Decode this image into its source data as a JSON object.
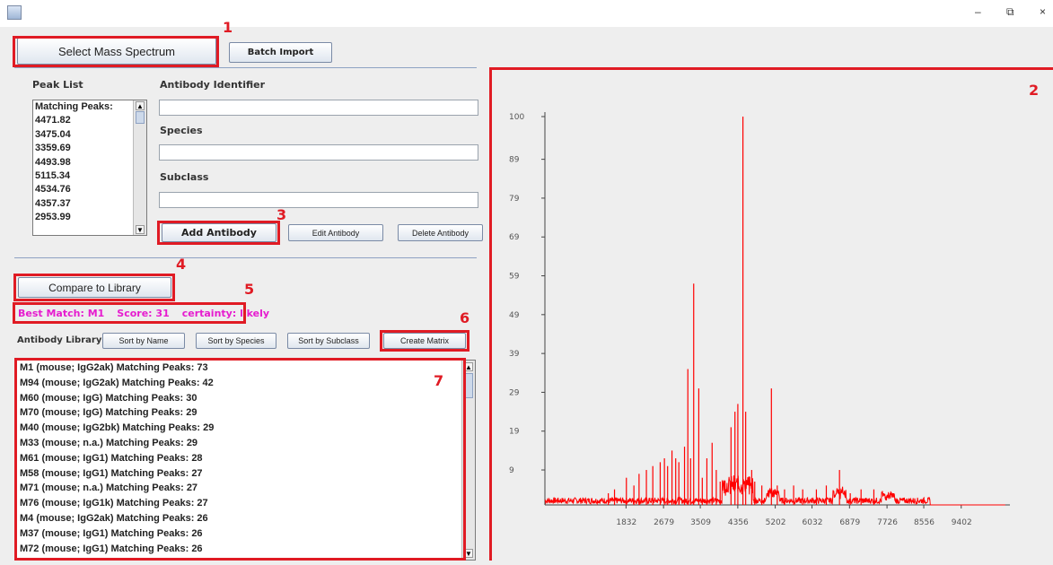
{
  "window": {
    "minimize": "–",
    "restore": "⧉",
    "close": "×"
  },
  "toolbar": {
    "select_mass_spectrum": "Select Mass Spectrum",
    "batch_import": "Batch Import"
  },
  "peak_list": {
    "label": "Peak List",
    "items": [
      "Matching Peaks:",
      "4471.82",
      "3475.04",
      "3359.69",
      "4493.98",
      "5115.34",
      "4534.76",
      "4357.37",
      "2953.99"
    ]
  },
  "antibody_form": {
    "identifier_label": "Antibody Identifier",
    "species_label": "Species",
    "subclass_label": "Subclass",
    "identifier_value": "",
    "species_value": "",
    "subclass_value": "",
    "add_button": "Add Antibody",
    "edit_button": "Edit Antibody",
    "delete_button": "Delete Antibody"
  },
  "compare_button": "Compare to Library",
  "best_match": {
    "match": "Best Match: M1",
    "score": "Score: 31",
    "certainty": "certainty: likely"
  },
  "library": {
    "label": "Antibody Library",
    "sort_name": "Sort by Name",
    "sort_species": "Sort by Species",
    "sort_subclass": "Sort by Subclass",
    "create_matrix": "Create Matrix",
    "items": [
      "M1 (mouse; IgG2ak) Matching Peaks: 73",
      "M94 (mouse; IgG2ak) Matching Peaks: 42",
      "M60 (mouse; IgG) Matching Peaks: 30",
      "M70 (mouse; IgG) Matching Peaks: 29",
      "M40 (mouse; IgG2bk) Matching Peaks: 29",
      "M33 (mouse; n.a.) Matching Peaks: 29",
      "M61 (mouse; IgG1) Matching Peaks: 28",
      "M58 (mouse; IgG1) Matching Peaks: 27",
      "M71 (mouse; n.a.) Matching Peaks: 27",
      "M76 (mouse; IgG1k) Matching Peaks: 27",
      "M4 (mouse; IgG2ak) Matching Peaks: 26",
      "M37 (mouse; IgG1) Matching Peaks: 26",
      "M72 (mouse; IgG1) Matching Peaks: 26"
    ]
  },
  "annotations": [
    "1",
    "2",
    "3",
    "4",
    "5",
    "6",
    "7"
  ],
  "colors": {
    "highlight": "#e01b24",
    "match_text": "#e61ccf",
    "spectrum": "#ff0000"
  },
  "chart_data": {
    "type": "line",
    "yticks": [
      "9",
      "19",
      "29",
      "39",
      "49",
      "59",
      "69",
      "79",
      "89",
      "100"
    ],
    "xticks": [
      "1832",
      "2679",
      "3509",
      "4356",
      "5202",
      "6032",
      "6879",
      "7726",
      "8556",
      "9402"
    ],
    "xlim": [
      0,
      10400
    ],
    "ylim": [
      0,
      100
    ],
    "peaks": [
      {
        "x": 1432,
        "y": 3
      },
      {
        "x": 1572,
        "y": 4
      },
      {
        "x": 1840,
        "y": 7
      },
      {
        "x": 2010,
        "y": 5
      },
      {
        "x": 2126,
        "y": 8
      },
      {
        "x": 2292,
        "y": 9
      },
      {
        "x": 2437,
        "y": 10
      },
      {
        "x": 2604,
        "y": 11
      },
      {
        "x": 2699,
        "y": 12
      },
      {
        "x": 2771,
        "y": 10
      },
      {
        "x": 2870,
        "y": 14
      },
      {
        "x": 2954,
        "y": 12
      },
      {
        "x": 3025,
        "y": 11
      },
      {
        "x": 3153,
        "y": 15
      },
      {
        "x": 3228,
        "y": 35
      },
      {
        "x": 3290,
        "y": 12
      },
      {
        "x": 3360,
        "y": 57
      },
      {
        "x": 3475,
        "y": 30
      },
      {
        "x": 3554,
        "y": 7
      },
      {
        "x": 3658,
        "y": 12
      },
      {
        "x": 3776,
        "y": 16
      },
      {
        "x": 3870,
        "y": 9
      },
      {
        "x": 3958,
        "y": 6
      },
      {
        "x": 4203,
        "y": 20
      },
      {
        "x": 4292,
        "y": 24
      },
      {
        "x": 4357,
        "y": 26
      },
      {
        "x": 4472,
        "y": 100
      },
      {
        "x": 4534,
        "y": 24
      },
      {
        "x": 4670,
        "y": 9
      },
      {
        "x": 4739,
        "y": 6
      },
      {
        "x": 4899,
        "y": 5
      },
      {
        "x": 5115,
        "y": 30
      },
      {
        "x": 5247,
        "y": 5
      },
      {
        "x": 5412,
        "y": 4
      },
      {
        "x": 5617,
        "y": 5
      },
      {
        "x": 5822,
        "y": 4
      },
      {
        "x": 6131,
        "y": 4
      },
      {
        "x": 6355,
        "y": 5
      },
      {
        "x": 6653,
        "y": 9
      },
      {
        "x": 6896,
        "y": 3
      },
      {
        "x": 7140,
        "y": 4
      },
      {
        "x": 7429,
        "y": 4
      }
    ]
  }
}
